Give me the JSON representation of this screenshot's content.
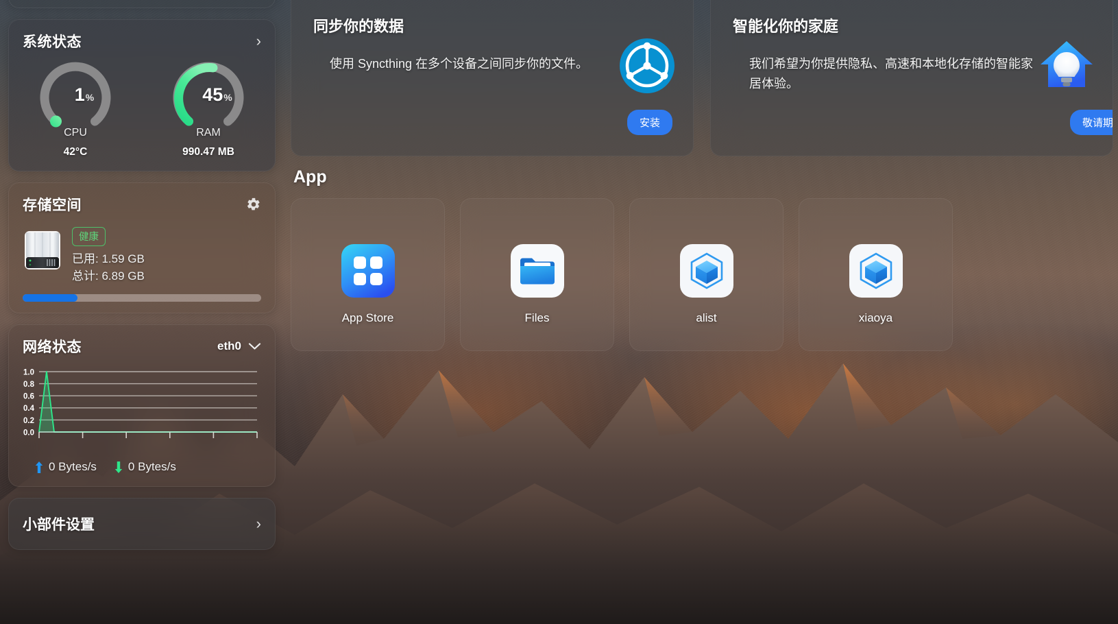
{
  "system_status": {
    "title": "系统状态",
    "expand_icon": "chevron-right-icon",
    "cpu": {
      "value": "1",
      "unit": "%",
      "label": "CPU",
      "sub": "42°C",
      "percent": 1
    },
    "ram": {
      "value": "45",
      "unit": "%",
      "label": "RAM",
      "sub": "990.47 MB",
      "percent": 45
    },
    "accent_color": "#4ade80"
  },
  "storage": {
    "title": "存储空间",
    "settings_icon": "gear-icon",
    "disk_icon": "hard-drive-icon",
    "health_badge": "健康",
    "used_line": "已用: 1.59 GB",
    "total_line": "总计: 6.89 GB",
    "used_percent": 23,
    "bar_color": "#1573e6",
    "badge_color": "#5ed47b"
  },
  "network": {
    "title": "网络状态",
    "interface": "eth0",
    "dropdown_icon": "chevron-down-icon",
    "upload_icon": "arrow-up-icon",
    "download_icon": "arrow-down-icon",
    "upload_rate": "0 Bytes/s",
    "download_rate": "0 Bytes/s",
    "upload_color": "#2196f3",
    "download_color": "#2ee68a"
  },
  "chart_data": {
    "type": "area",
    "title": "网络状态",
    "xlabel": "",
    "ylabel": "",
    "ylim": [
      0,
      1.0
    ],
    "ytick_labels": [
      "1.0",
      "0.8",
      "0.6",
      "0.4",
      "0.2",
      "0.0"
    ],
    "yticks": [
      1.0,
      0.8,
      0.6,
      0.4,
      0.2,
      0.0
    ],
    "grid": true,
    "legend": "none",
    "x": [
      0,
      1,
      2,
      3,
      4,
      5,
      6,
      7,
      8,
      9,
      10,
      11,
      12,
      13,
      14,
      15,
      16,
      17,
      18,
      19,
      20,
      21,
      22,
      23,
      24,
      25,
      26,
      27,
      28,
      29
    ],
    "series": [
      {
        "name": "eth0",
        "color": "#2ee68a",
        "values": [
          0,
          1.0,
          0,
          0,
          0,
          0,
          0,
          0,
          0,
          0,
          0,
          0,
          0,
          0,
          0,
          0,
          0,
          0,
          0,
          0,
          0,
          0,
          0,
          0,
          0,
          0,
          0,
          0,
          0,
          0
        ]
      }
    ],
    "x_tick_count": 6
  },
  "widget_settings": {
    "title": "小部件设置",
    "expand_icon": "chevron-right-icon"
  },
  "promos": [
    {
      "id": "syncthing",
      "title": "同步你的数据",
      "description": "使用 Syncthing 在多个设备之间同步你的文件。",
      "button_label": "安装",
      "icon": "syncthing-icon",
      "button_color": "#2f7af0"
    },
    {
      "id": "smarthome",
      "title": "智能化你的家庭",
      "description": "我们希望为你提供隐私、高速和本地化存储的智能家居体验。",
      "button_label": "敬请期待",
      "icon": "smart-home-bulb-icon",
      "button_color": "#2f7af0"
    }
  ],
  "apps": {
    "heading": "App",
    "items": [
      {
        "label": "App Store",
        "icon": "app-store-icon"
      },
      {
        "label": "Files",
        "icon": "folder-icon"
      },
      {
        "label": "alist",
        "icon": "cube-hexagon-icon"
      },
      {
        "label": "xiaoya",
        "icon": "cube-hexagon-icon"
      }
    ]
  }
}
